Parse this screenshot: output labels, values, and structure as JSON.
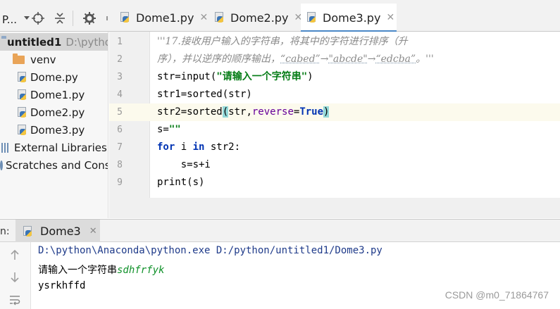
{
  "toolbar": {
    "project_menu": "P...",
    "tabs": [
      {
        "label": "Dome1.py",
        "active": false
      },
      {
        "label": "Dome2.py",
        "active": false
      },
      {
        "label": "Dome3.py",
        "active": true
      }
    ],
    "close_glyph": "✕"
  },
  "tree": {
    "root": {
      "name": "untitled1",
      "path": "D:\\pytho"
    },
    "items": [
      {
        "name": "venv",
        "type": "folder"
      },
      {
        "name": "Dome.py",
        "type": "python"
      },
      {
        "name": "Dome1.py",
        "type": "python"
      },
      {
        "name": "Dome2.py",
        "type": "python"
      },
      {
        "name": "Dome3.py",
        "type": "python"
      },
      {
        "name": "External Libraries",
        "type": "library"
      },
      {
        "name": "Scratches and Cons",
        "type": "scratch"
      }
    ]
  },
  "editor": {
    "line_numbers": [
      "1",
      "2",
      "3",
      "4",
      "5",
      "6",
      "7",
      "8",
      "9"
    ],
    "current_line": "5",
    "lines": {
      "l1": "'''17.接收用户输入的字符串，将其中的字符进行排序（升",
      "l2a": "序），并以逆序的顺序输出，",
      "l2b": "“cabed”",
      "l2c": "→",
      "l2d": "\"abcde\"",
      "l2e": "→",
      "l2f": "“edcba”",
      "l2g": "。'''",
      "l3a": "str=input(",
      "l3b": "\"请输入一个字符串\"",
      "l3c": ")",
      "l4": "str1=sorted(str)",
      "l5a": "str2=sorted",
      "l5b": "(",
      "l5c": "str,",
      "l5d": "reverse",
      "l5e": "=",
      "l5f": "True",
      "l5g": ")",
      "l6a": "s=",
      "l6b": "\"\"",
      "l7a": "for",
      "l7b": " i ",
      "l7c": "in",
      "l7d": " str2:",
      "l8": "    s=s+i",
      "l9": "print(s)"
    }
  },
  "run": {
    "label": "n:",
    "tab": "Dome3",
    "command": "D:\\python\\Anaconda\\python.exe D:/python/untitled1/Dome3.py",
    "prompt": "请输入一个字符串",
    "user_input": "sdhfrfyk",
    "output": "ysrkhffd"
  },
  "watermark": "CSDN @m0_71864767",
  "colors": {
    "accent_tab": "#4a88c7",
    "keyword": "#0033b3",
    "string": "#067d17",
    "kwarg": "#660099",
    "docstring": "#8a8a8a",
    "console_input": "#10912a",
    "current_line": "#fcfaed"
  }
}
